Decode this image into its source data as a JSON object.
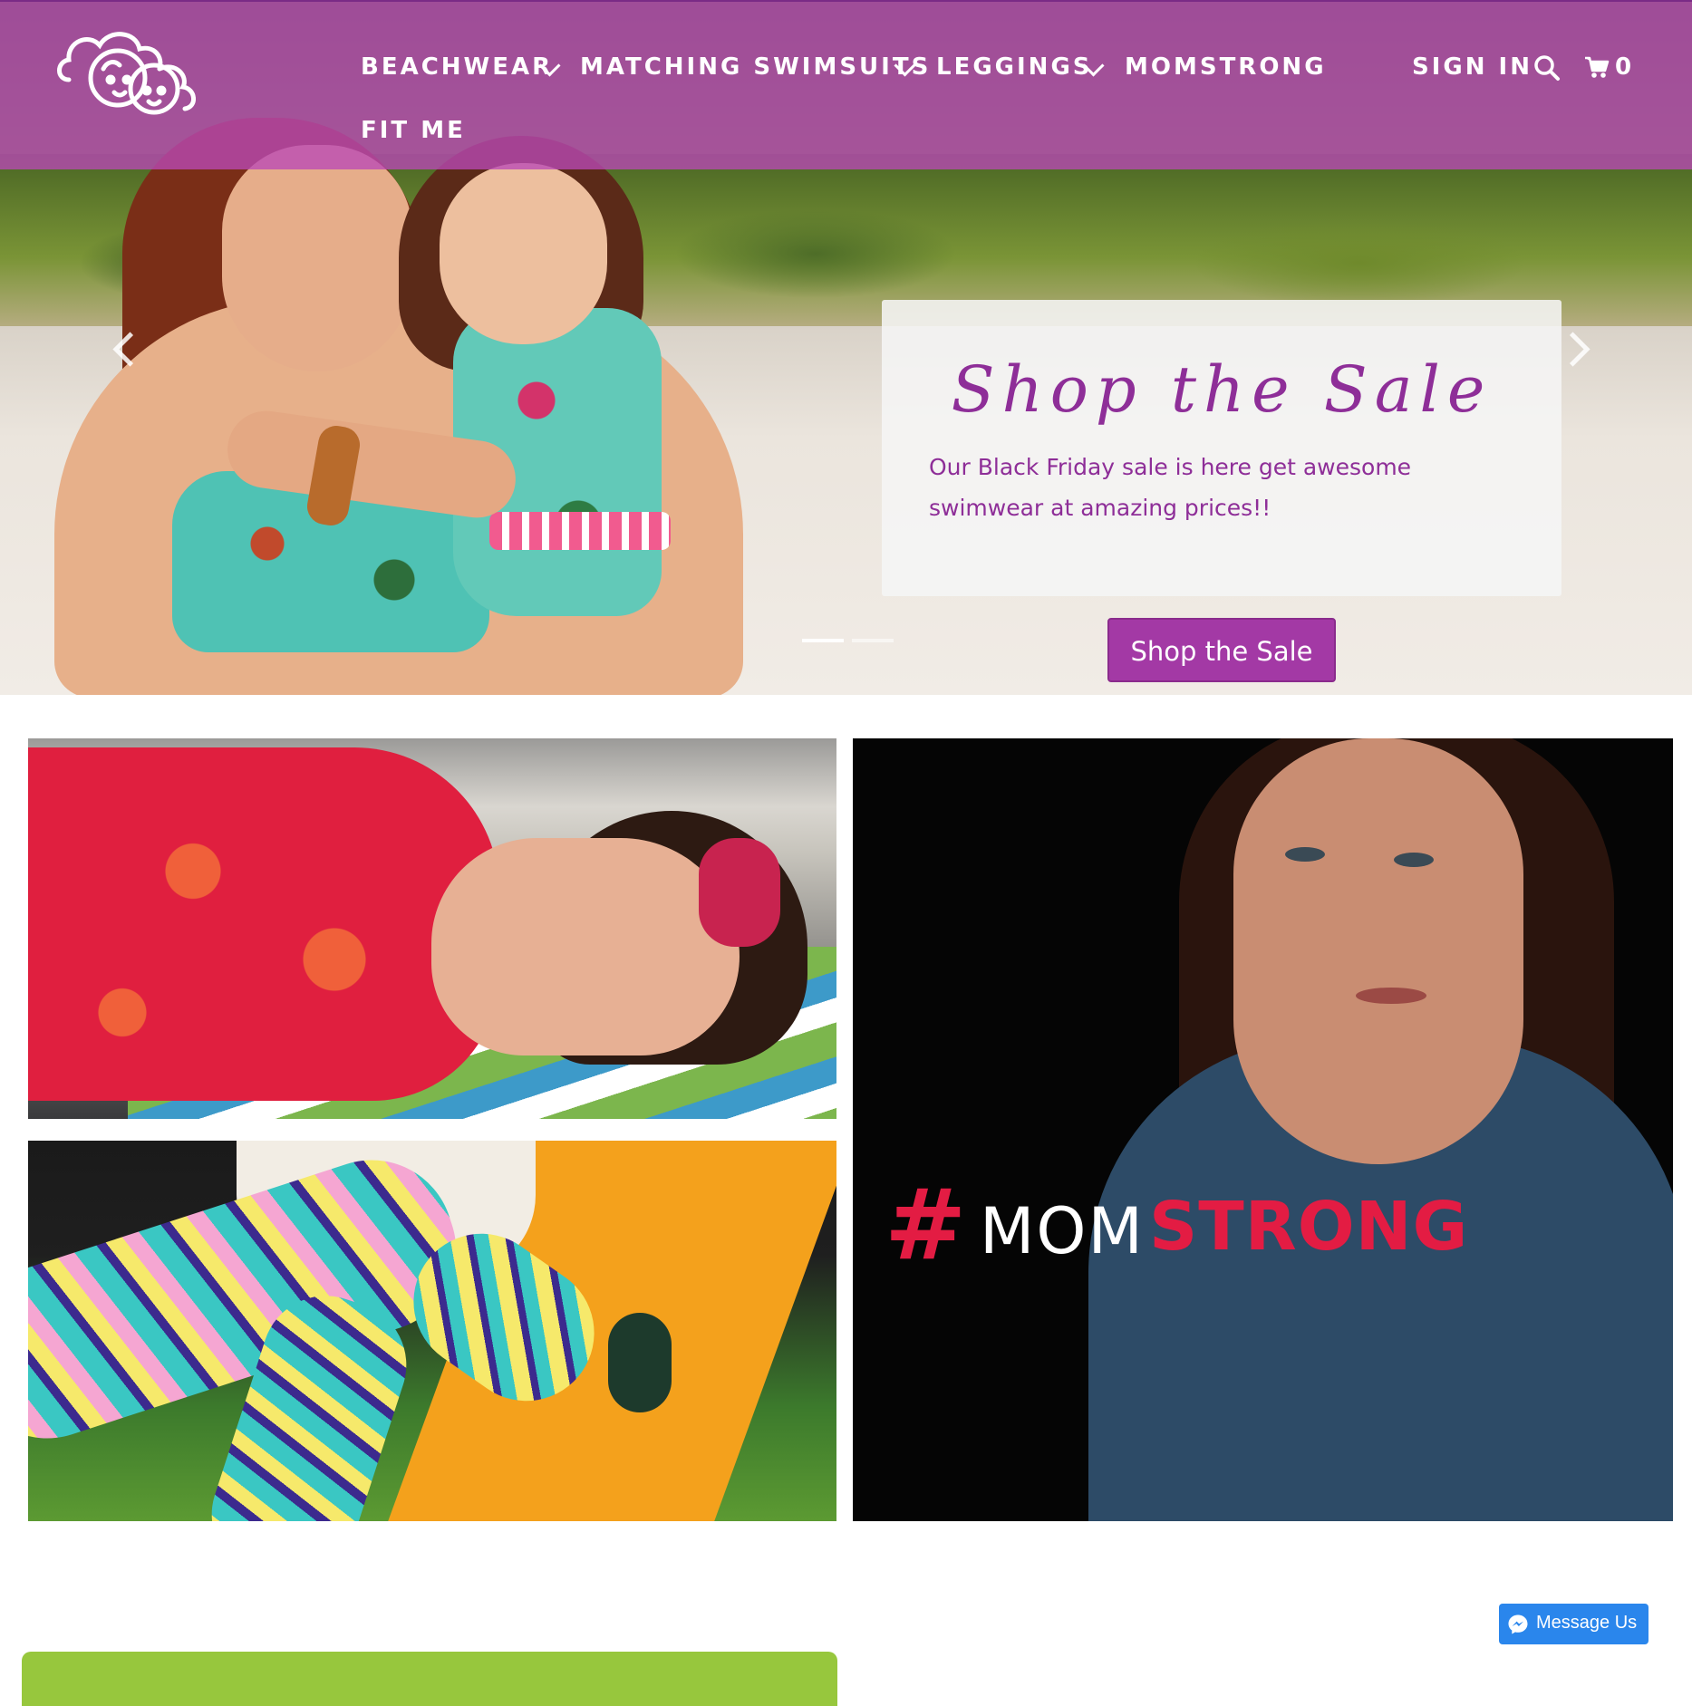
{
  "header": {
    "logo_icon": "two-baby-faces-cloud-logo",
    "nav": {
      "beachwear": "BEACHWEAR",
      "matching_swimsuits": "MATCHING SWIMSUITS",
      "leggings": "LEGGINGS",
      "momstrong": "MOMSTRONG",
      "fit_me": "FIT ME"
    },
    "sign_in": "SIGN IN",
    "search_icon": "search-icon",
    "cart_icon": "cart-icon",
    "cart_count": "0"
  },
  "slider": {
    "title": "Shop the Sale",
    "text": "Our Black Friday sale is here get awesome swimwear at amazing prices!!",
    "button": "Shop the Sale",
    "slide_count": 2,
    "active_slide": 1
  },
  "tiles": {
    "momstrong_hash": "#",
    "momstrong_mom": "MOM",
    "momstrong_strong": "STRONG"
  },
  "messenger": {
    "label": "Message Us",
    "icon": "messenger-icon"
  },
  "colors": {
    "nav_overlay": "#ba49b6",
    "accent_purple": "#a339a5",
    "caption_text": "#8e2e98",
    "momstrong_red": "#e31c43",
    "messenger_blue": "#2a86ec",
    "footer_green": "#97c73d"
  }
}
